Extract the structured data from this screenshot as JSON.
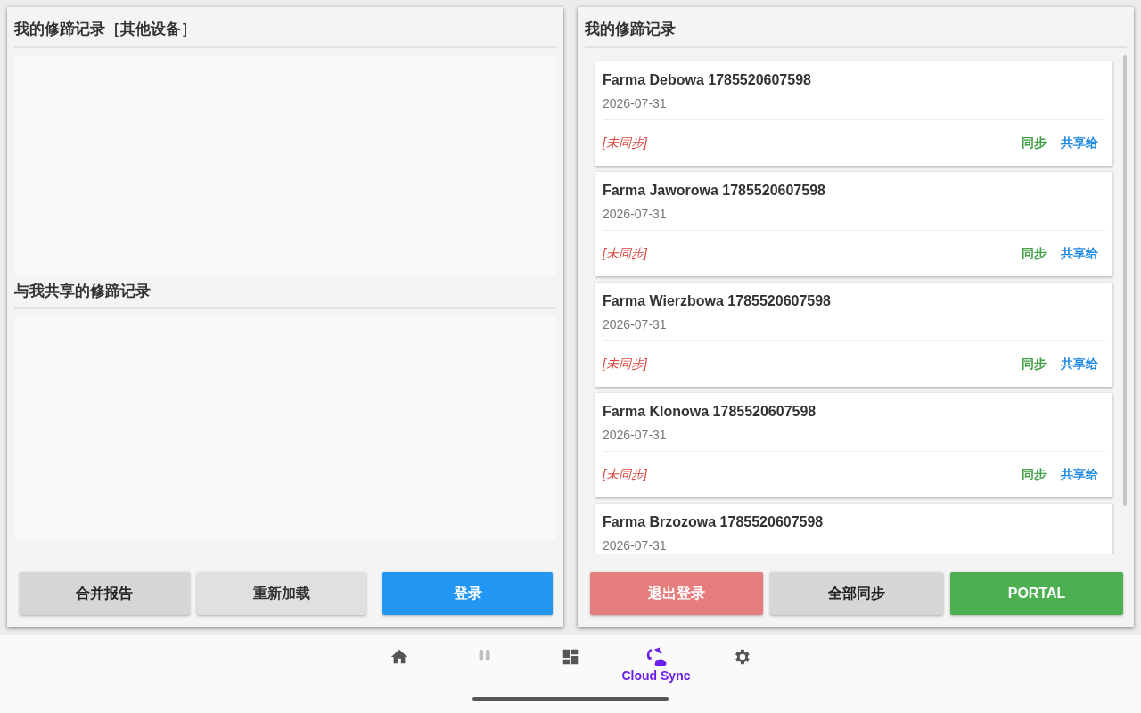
{
  "left_panel": {
    "sections": [
      {
        "title": "我的修蹄记录［其他设备］"
      },
      {
        "title": "与我共享的修蹄记录"
      }
    ],
    "buttons": [
      {
        "label": "合并报告",
        "kind": "grey"
      },
      {
        "label": "重新加载",
        "kind": "light"
      },
      {
        "label": "登录",
        "kind": "primary"
      }
    ]
  },
  "right_panel": {
    "title": "我的修蹄记录",
    "records": [
      {
        "title": "Farma Debowa 1785520607598",
        "date": "2026-07-31",
        "status": "[未同步]",
        "sync": "同步",
        "share": "共享给"
      },
      {
        "title": "Farma Jaworowa 1785520607598",
        "date": "2026-07-31",
        "status": "[未同步]",
        "sync": "同步",
        "share": "共享给"
      },
      {
        "title": "Farma Wierzbowa 1785520607598",
        "date": "2026-07-31",
        "status": "[未同步]",
        "sync": "同步",
        "share": "共享给"
      },
      {
        "title": "Farma Klonowa 1785520607598",
        "date": "2026-07-31",
        "status": "[未同步]",
        "sync": "同步",
        "share": "共享给"
      },
      {
        "title": "Farma Brzozowa 1785520607598",
        "date": "2026-07-31"
      }
    ],
    "buttons": [
      {
        "label": "退出登录",
        "kind": "danger"
      },
      {
        "label": "全部同步",
        "kind": "grey"
      },
      {
        "label": "PORTAL",
        "kind": "success"
      }
    ]
  },
  "bottom_nav": [
    {
      "kind": "home",
      "selected": false,
      "disabled": false
    },
    {
      "kind": "pause",
      "selected": false,
      "disabled": true
    },
    {
      "kind": "dashboard",
      "selected": false,
      "disabled": false
    },
    {
      "kind": "cloud",
      "label": "Cloud Sync",
      "selected": true,
      "disabled": false
    },
    {
      "kind": "settings",
      "selected": false,
      "disabled": false
    }
  ]
}
